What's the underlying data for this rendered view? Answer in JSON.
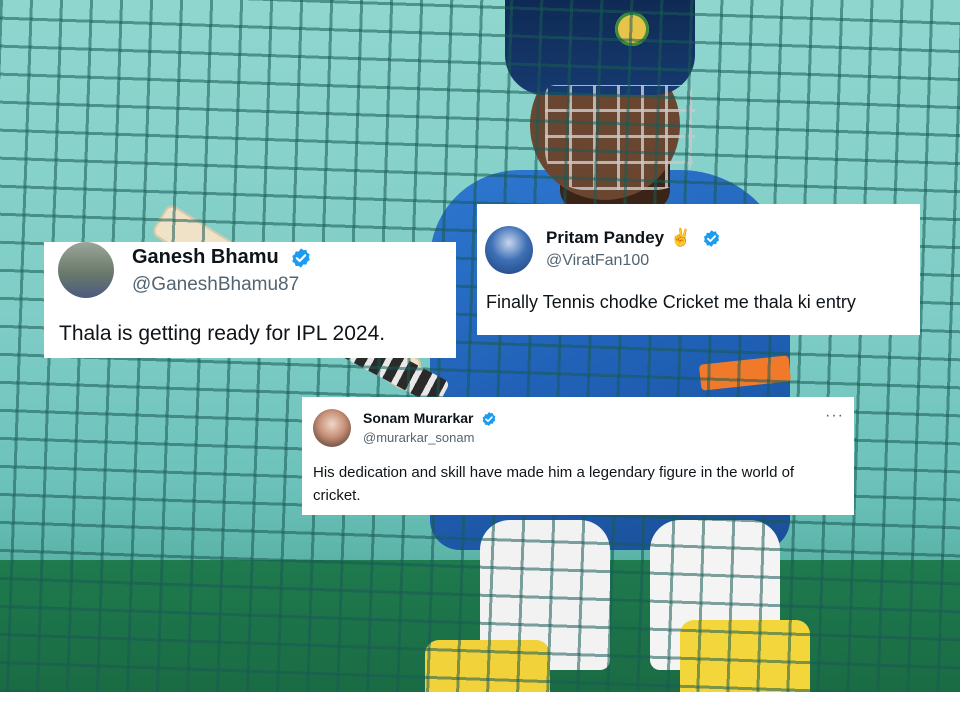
{
  "tweets": [
    {
      "name": "Ganesh Bhamu",
      "handle": "@GaneshBhamu87",
      "text": "Thala is getting ready for IPL 2024."
    },
    {
      "name": "Pritam Pandey",
      "emoji": "✌",
      "handle": "@ViratFan100",
      "text": "Finally Tennis chodke Cricket me thala ki entry"
    },
    {
      "name": "Sonam Murarkar",
      "handle": "@murarkar_sonam",
      "more": "···",
      "text": "His dedication and skill have made him a legendary figure in the world of cricket."
    }
  ],
  "colors": {
    "verified_blue": "#1d9bf0",
    "handle_gray": "#536471",
    "text_dark": "#0f1419"
  },
  "icons": [
    "verified-badge-icon",
    "more-options-icon"
  ]
}
